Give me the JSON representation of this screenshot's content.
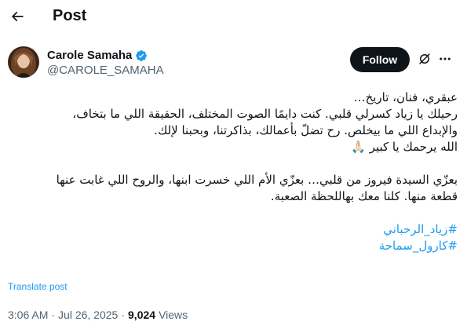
{
  "header": {
    "title": "Post"
  },
  "author": {
    "name": "Carole Samaha",
    "handle": "@CAROLE_SAMAHA",
    "verified": true
  },
  "actions": {
    "follow_label": "Follow"
  },
  "tweet": {
    "lines": [
      "عبقري، فنان، تاريخ…",
      "رحيلك يا زياد كسرلي قلبي. كنت دايمًا الصوت المختلف، الحقيقة اللي ما بتخاف،",
      "والإبداع اللي ما بيخلص. رح تضلّ بأعمالك، بذاكرتنا، وبحبنا لإلك.",
      "الله يرحمك يا كبير 🙏🏻",
      "",
      "بعزّي السيدة فيروز من قلبي… بعزّي الأم اللي خسرت ابنها، والروح اللي غابت عنها",
      "قطعة منها. كلنا معك بهاللحظة الصعبة."
    ],
    "hashtags": [
      "#زياد_الرحباني",
      "#كارول_سماحة"
    ]
  },
  "translate_label": "Translate post",
  "meta": {
    "time": "3:06 AM",
    "date": "Jul 26, 2025",
    "views_count": "9,024",
    "views_label": "Views"
  },
  "colors": {
    "accent": "#1d9bf0",
    "text": "#0f1419",
    "secondary": "#536471",
    "follow_bg": "#0f1419"
  }
}
